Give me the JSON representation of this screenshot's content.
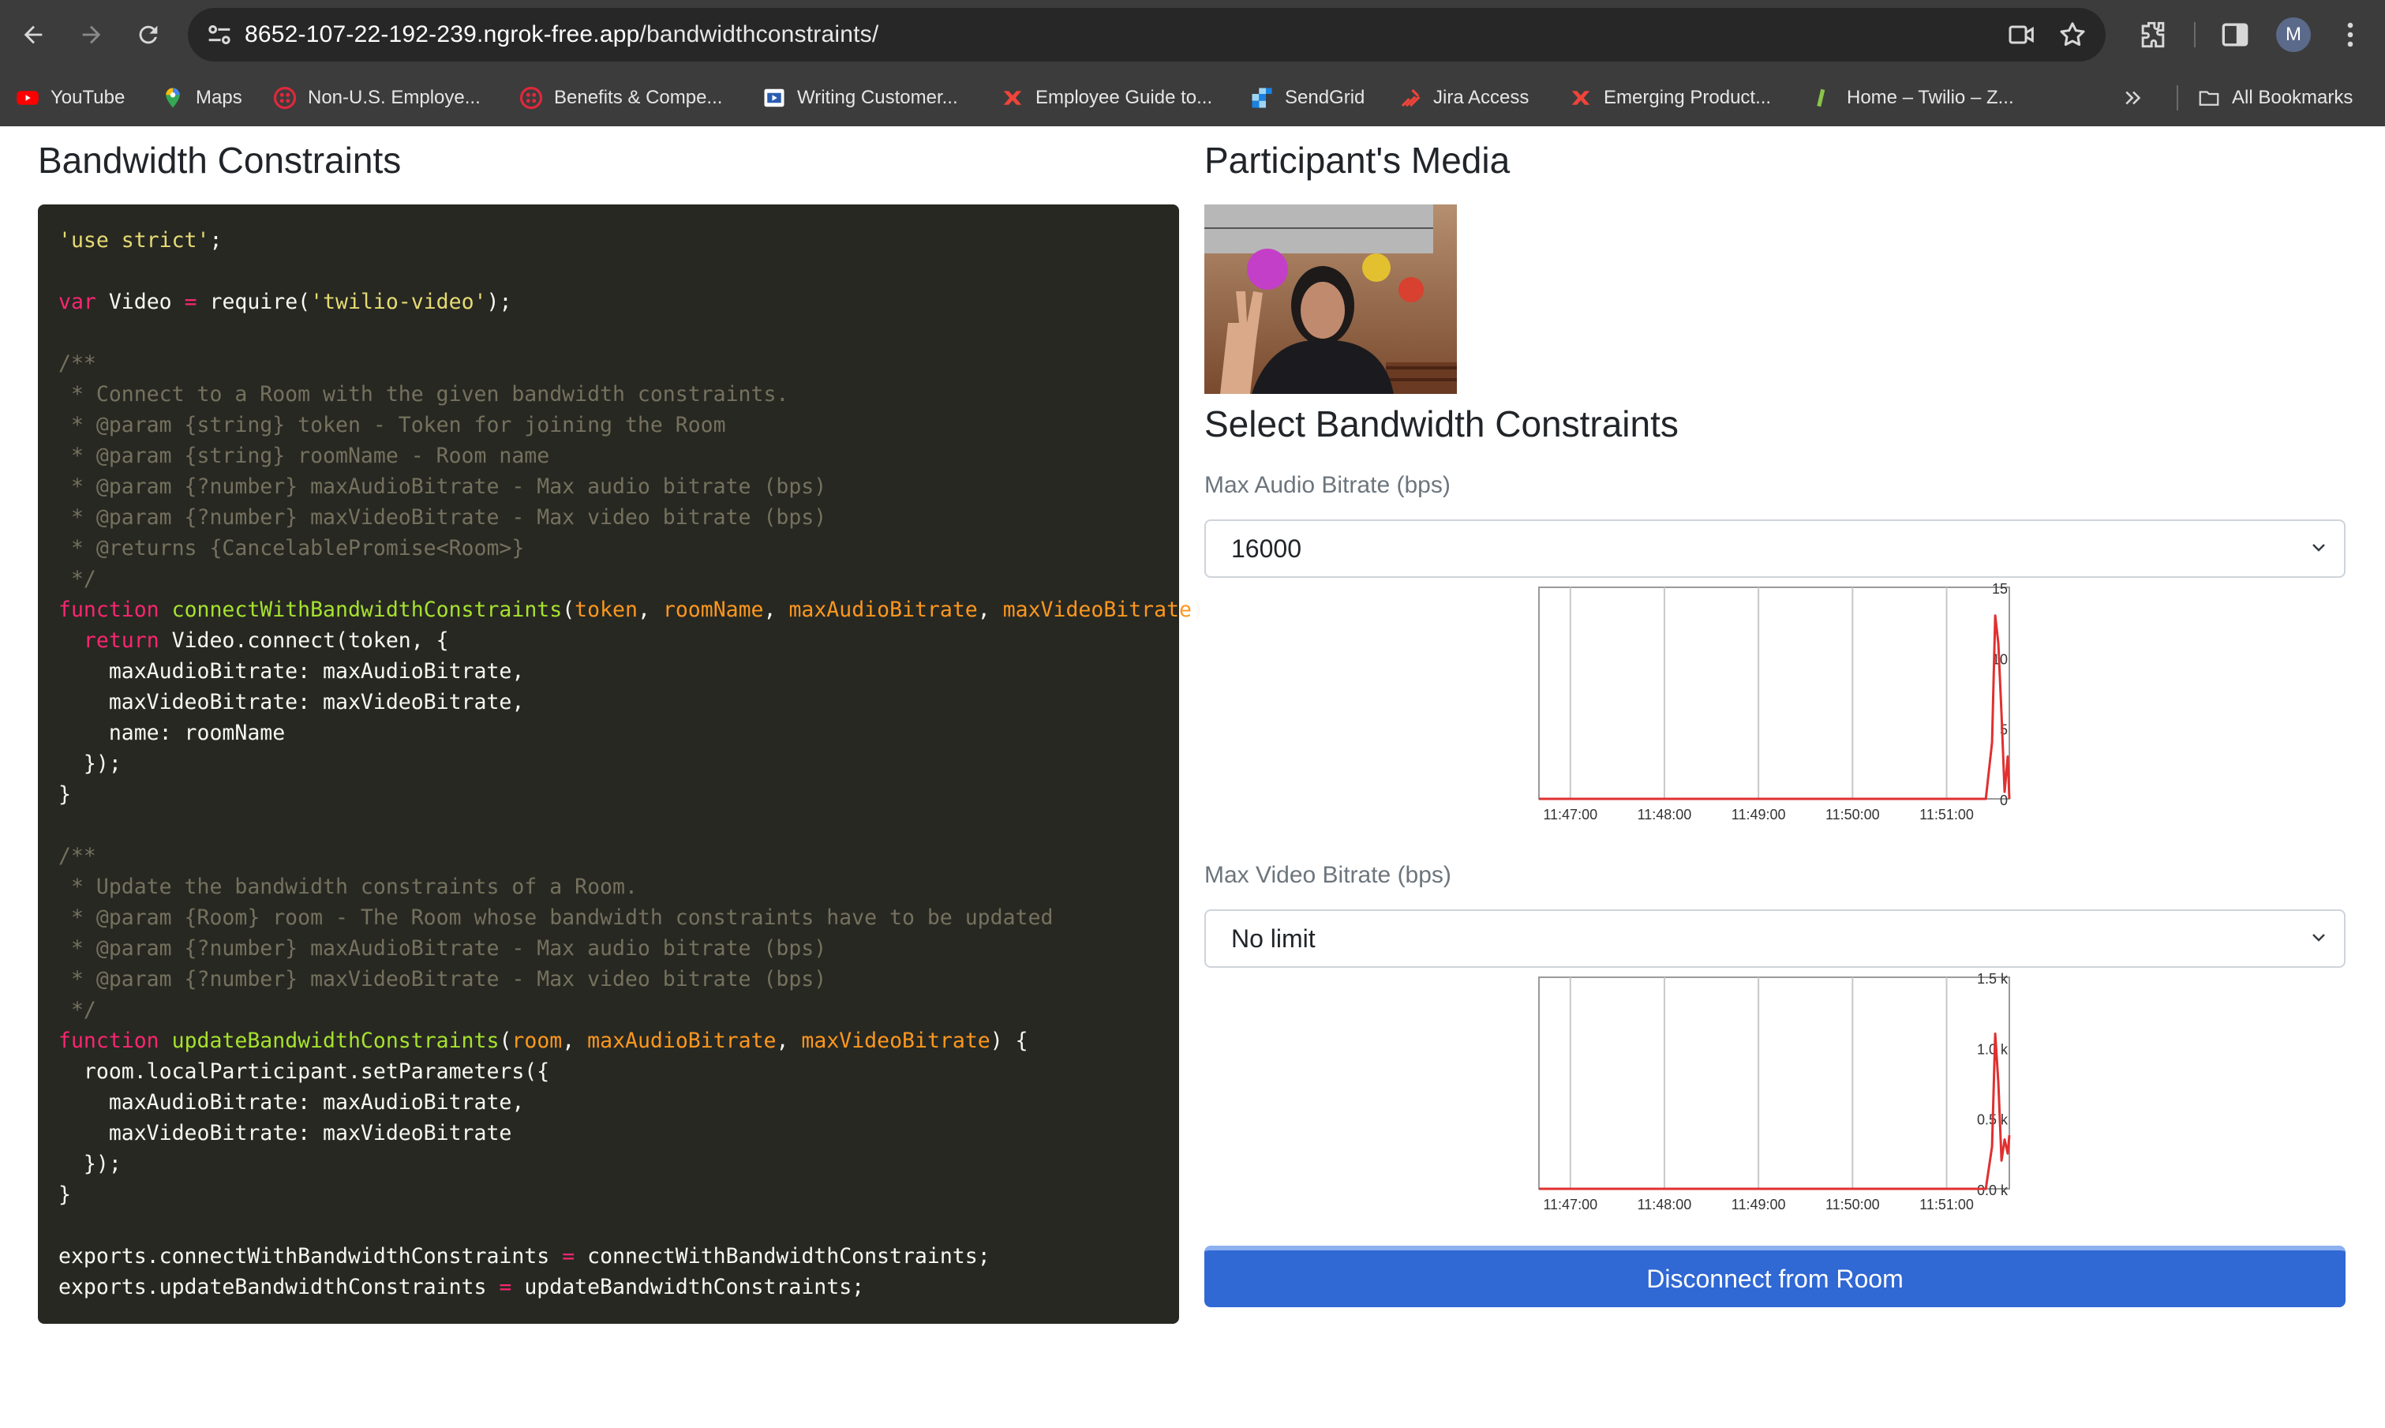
{
  "browser": {
    "url_host": "8652-107-22-192-239.ngrok-free.app",
    "url_path": "/bandwidthconstraints/",
    "profile_initial": "M",
    "bookmarks": [
      {
        "label": "YouTube",
        "icon": "youtube-icon"
      },
      {
        "label": "Maps",
        "icon": "maps-icon"
      },
      {
        "label": "Non-U.S. Employe...",
        "icon": "twilio-icon"
      },
      {
        "label": "Benefits & Compe...",
        "icon": "twilio-icon"
      },
      {
        "label": "Writing Customer...",
        "icon": "document-icon"
      },
      {
        "label": "Employee Guide to...",
        "icon": "red-x-icon"
      },
      {
        "label": "SendGrid",
        "icon": "sendgrid-icon"
      },
      {
        "label": "Jira Access",
        "icon": "jira-icon"
      },
      {
        "label": "Emerging Product...",
        "icon": "red-x-icon"
      },
      {
        "label": "Home – Twilio – Z...",
        "icon": "green-tab-icon"
      }
    ],
    "all_bookmarks_label": "All Bookmarks"
  },
  "left": {
    "title": "Bandwidth Constraints"
  },
  "right": {
    "media_title": "Participant's Media",
    "select_title": "Select Bandwidth Constraints",
    "audio_label": "Max Audio Bitrate (bps)",
    "audio_value": "16000",
    "video_label": "Max Video Bitrate (bps)",
    "video_value": "No limit",
    "disconnect_label": "Disconnect from Room"
  },
  "chart_data": [
    {
      "type": "line",
      "x_ticks": [
        "11:47:00",
        "11:48:00",
        "11:49:00",
        "11:50:00",
        "11:51:00"
      ],
      "y_ticks": [
        "15",
        "10",
        "5",
        "0"
      ],
      "ylim": [
        0,
        15
      ],
      "series": [
        {
          "color": "#e03030",
          "points": [
            [
              "11:46:40",
              0
            ],
            [
              "11:47:30",
              0
            ],
            [
              "11:48:30",
              0
            ],
            [
              "11:49:30",
              0
            ],
            [
              "11:50:30",
              0
            ],
            [
              "11:51:25",
              0
            ],
            [
              "11:51:29",
              4
            ],
            [
              "11:51:31",
              13
            ],
            [
              "11:51:33",
              11
            ],
            [
              "11:51:35",
              6
            ],
            [
              "11:51:37",
              0.5
            ],
            [
              "11:51:39",
              3
            ],
            [
              "11:51:40",
              0
            ]
          ]
        }
      ]
    },
    {
      "type": "line",
      "x_ticks": [
        "11:47:00",
        "11:48:00",
        "11:49:00",
        "11:50:00",
        "11:51:00"
      ],
      "y_ticks": [
        "1.5 k",
        "1.0 k",
        "0.5 k",
        "0.0 k"
      ],
      "ylim": [
        0,
        1500
      ],
      "series": [
        {
          "color": "#e03030",
          "points": [
            [
              "11:46:40",
              0
            ],
            [
              "11:47:30",
              0
            ],
            [
              "11:48:30",
              0
            ],
            [
              "11:49:30",
              0
            ],
            [
              "11:50:30",
              0
            ],
            [
              "11:51:25",
              0
            ],
            [
              "11:51:29",
              300
            ],
            [
              "11:51:31",
              1100
            ],
            [
              "11:51:33",
              750
            ],
            [
              "11:51:35",
              200
            ],
            [
              "11:51:37",
              350
            ],
            [
              "11:51:39",
              250
            ],
            [
              "11:51:40",
              380
            ]
          ]
        }
      ]
    }
  ]
}
